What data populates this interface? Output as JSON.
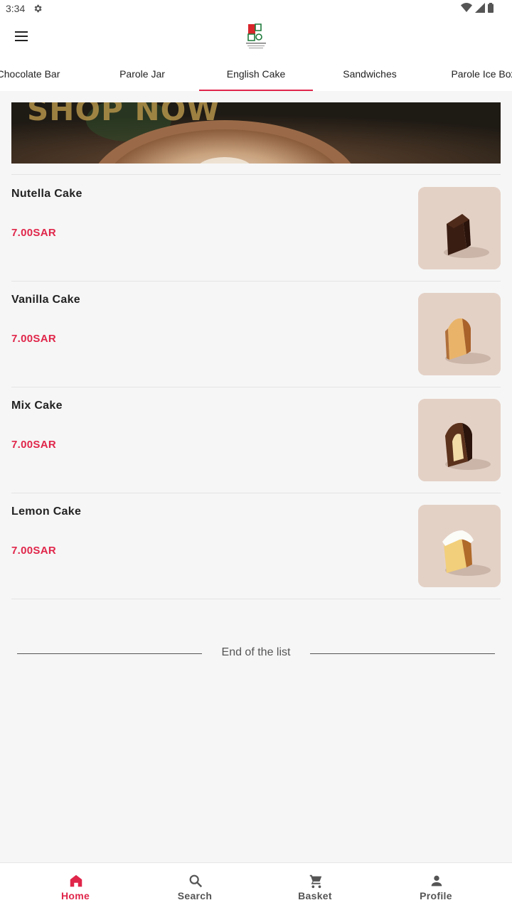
{
  "status_bar": {
    "time": "3:34",
    "icons": [
      "settings-icon",
      "wifi-icon",
      "signal-icon",
      "battery-icon"
    ]
  },
  "app_bar": {
    "menu_icon": "hamburger-menu-icon",
    "logo": "parole-logo"
  },
  "tabs": [
    {
      "label": "Chocolate Bar",
      "active": false
    },
    {
      "label": "Parole Jar",
      "active": false
    },
    {
      "label": "English Cake",
      "active": true
    },
    {
      "label": "Sandwiches",
      "active": false
    },
    {
      "label": "Parole Ice Box",
      "active": false
    }
  ],
  "banner": {
    "text": "SHOP NOW"
  },
  "products": [
    {
      "name": "Nutella Cake",
      "price": "7.00SAR"
    },
    {
      "name": "Vanilla Cake",
      "price": "7.00SAR"
    },
    {
      "name": "Mix Cake",
      "price": "7.00SAR"
    },
    {
      "name": "Lemon Cake",
      "price": "7.00SAR"
    }
  ],
  "end_of_list": "End of the list",
  "bottom_nav": [
    {
      "label": "Home",
      "icon": "home-icon",
      "active": true
    },
    {
      "label": "Search",
      "icon": "search-icon",
      "active": false
    },
    {
      "label": "Basket",
      "icon": "cart-icon",
      "active": false
    },
    {
      "label": "Profile",
      "icon": "person-icon",
      "active": false
    }
  ],
  "colors": {
    "accent": "#e0264a",
    "background": "#f6f6f6",
    "surface": "#ffffff"
  }
}
